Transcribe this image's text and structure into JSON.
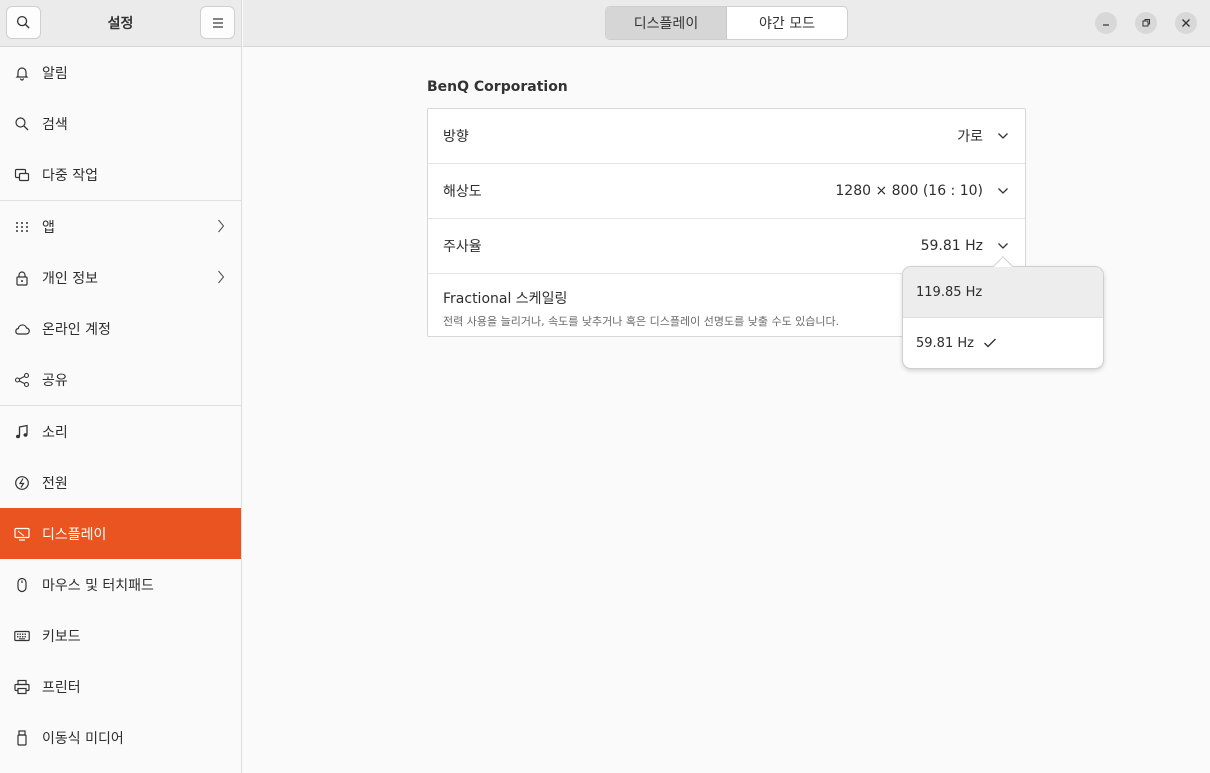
{
  "sidebar": {
    "title": "설정",
    "groups": [
      [
        {
          "label": "알림",
          "icon": "bell-icon"
        },
        {
          "label": "검색",
          "icon": "search-icon"
        },
        {
          "label": "다중 작업",
          "icon": "multitasking-icon"
        }
      ],
      [
        {
          "label": "앱",
          "icon": "apps-grid-icon",
          "chevron": true
        },
        {
          "label": "개인 정보",
          "icon": "lock-icon",
          "chevron": true
        },
        {
          "label": "온라인 계정",
          "icon": "cloud-icon"
        },
        {
          "label": "공유",
          "icon": "share-icon"
        }
      ],
      [
        {
          "label": "소리",
          "icon": "music-note-icon"
        },
        {
          "label": "전원",
          "icon": "power-icon"
        },
        {
          "label": "디스플레이",
          "icon": "display-icon",
          "active": true
        },
        {
          "label": "마우스 및 터치패드",
          "icon": "mouse-icon"
        },
        {
          "label": "키보드",
          "icon": "keyboard-icon"
        },
        {
          "label": "프린터",
          "icon": "printer-icon"
        },
        {
          "label": "이동식 미디어",
          "icon": "usb-icon"
        }
      ]
    ]
  },
  "header": {
    "tabs": [
      {
        "label": "디스플레이",
        "active": true
      },
      {
        "label": "야간 모드",
        "active": false
      }
    ]
  },
  "display": {
    "monitor_name": "BenQ Corporation",
    "rows": {
      "orientation": {
        "label": "방향",
        "value": "가로"
      },
      "resolution": {
        "label": "해상도",
        "value": "1280 × 800 (16 : 10)"
      },
      "refresh": {
        "label": "주사율",
        "value": "59.81 Hz"
      },
      "scaling": {
        "label": "Fractional 스케일링",
        "subtitle": "전력 사용을 늘리거나, 속도를 낮추거나 혹은 디스플레이 선명도를 낮출 수도 있습니다."
      }
    }
  },
  "refresh_popover": {
    "options": [
      {
        "label": "119.85 Hz",
        "selected": false
      },
      {
        "label": "59.81 Hz",
        "selected": true
      }
    ]
  },
  "colors": {
    "accent": "#e95420"
  }
}
